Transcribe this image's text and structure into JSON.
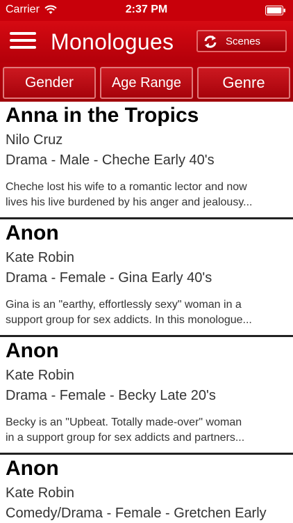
{
  "status": {
    "carrier": "Carrier",
    "time": "2:37 PM"
  },
  "nav": {
    "title": "Monologues",
    "scenes_label": "Scenes"
  },
  "filters": {
    "gender": "Gender",
    "age_range": "Age Range",
    "genre": "Genre"
  },
  "items": [
    {
      "title": "Anna in the Tropics",
      "author": "Nilo Cruz",
      "meta": "Drama - Male - Cheche Early 40's",
      "desc_line1": "Cheche lost his wife to a romantic lector and now",
      "desc_line2": "lives his live burdened by his anger and jealousy..."
    },
    {
      "title": "Anon",
      "author": "Kate Robin",
      "meta": "Drama - Female - Gina Early 40's",
      "desc_line1": "Gina is an \"earthy, effortlessly sexy\" woman in a",
      "desc_line2": "support group for sex addicts.  In this monologue..."
    },
    {
      "title": "Anon",
      "author": "Kate Robin",
      "meta": "Drama - Female - Becky Late 20's",
      "desc_line1": "Becky is an \"Upbeat. Totally made-over\" woman",
      "desc_line2": "in a support group for sex addicts and partners..."
    },
    {
      "title": "Anon",
      "author": "Kate Robin",
      "meta": "Comedy/Drama - Female - Gretchen Early",
      "desc_line1": "",
      "desc_line2": ""
    }
  ],
  "colors": {
    "accent": "#c8000a",
    "divider": "#222222"
  }
}
